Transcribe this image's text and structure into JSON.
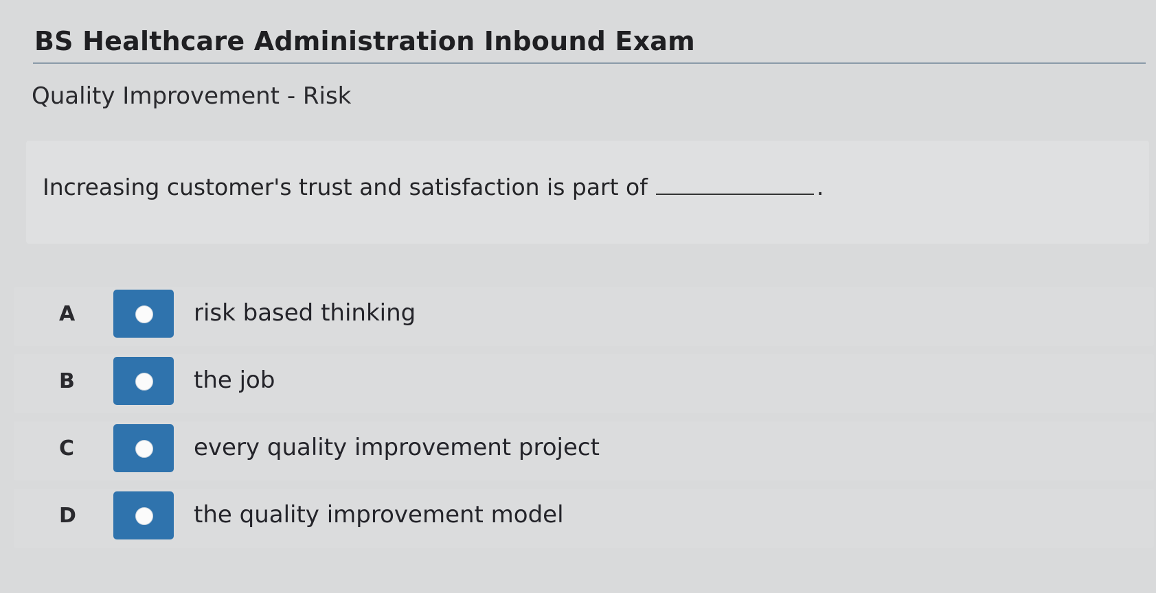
{
  "page": {
    "title": "BS Healthcare Administration Inbound Exam",
    "section": "Quality Improvement - Risk"
  },
  "question": {
    "text": "Increasing customer's trust and satisfaction is part of",
    "end_punctuation": "."
  },
  "options": [
    {
      "letter": "A",
      "text": "risk based thinking"
    },
    {
      "letter": "B",
      "text": "the job"
    },
    {
      "letter": "C",
      "text": "every quality improvement project"
    },
    {
      "letter": "D",
      "text": "the quality improvement model"
    }
  ],
  "colors": {
    "radio_accent": "#2f73ad",
    "background": "#d9dadb"
  }
}
